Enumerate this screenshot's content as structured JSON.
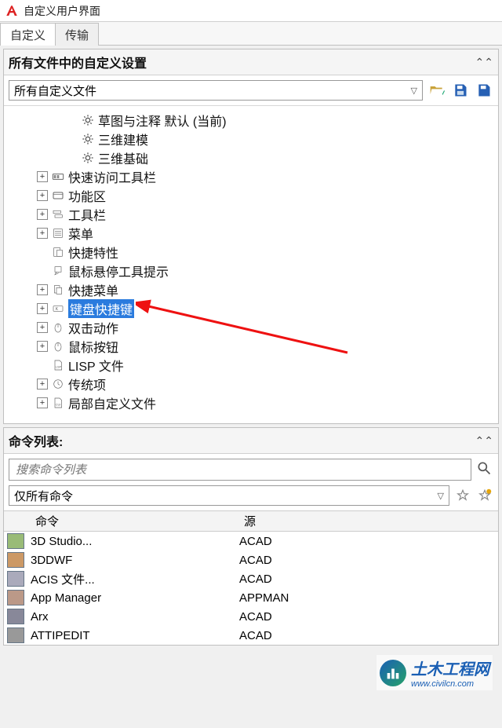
{
  "window": {
    "title": "自定义用户界面"
  },
  "tabs": {
    "customize": "自定义",
    "transfer": "传输"
  },
  "section1": {
    "title": "所有文件中的自定义设置",
    "combo": "所有自定义文件"
  },
  "tree": {
    "n0": "草图与注释 默认 (当前)",
    "n1": "三维建模",
    "n2": "三维基础",
    "n3": "快速访问工具栏",
    "n4": "功能区",
    "n5": "工具栏",
    "n6": "菜单",
    "n7": "快捷特性",
    "n8": "鼠标悬停工具提示",
    "n9": "快捷菜单",
    "n10": "键盘快捷键",
    "n11": "双击动作",
    "n12": "鼠标按钮",
    "n13": "LISP 文件",
    "n14": "传统项",
    "n15": "局部自定义文件"
  },
  "cmdlist": {
    "title": "命令列表:",
    "search_placeholder": "搜索命令列表",
    "filter": "仅所有命令",
    "col_cmd": "命令",
    "col_src": "源",
    "rows": [
      {
        "name": "3D Studio...",
        "src": "ACAD"
      },
      {
        "name": "3DDWF",
        "src": "ACAD"
      },
      {
        "name": "ACIS 文件...",
        "src": "ACAD"
      },
      {
        "name": "App Manager",
        "src": "APPMAN"
      },
      {
        "name": "Arx",
        "src": "ACAD"
      },
      {
        "name": "ATTIPEDIT",
        "src": "ACAD"
      }
    ]
  },
  "watermark": {
    "brand": "土木工程网",
    "url": "www.civilcn.com"
  }
}
